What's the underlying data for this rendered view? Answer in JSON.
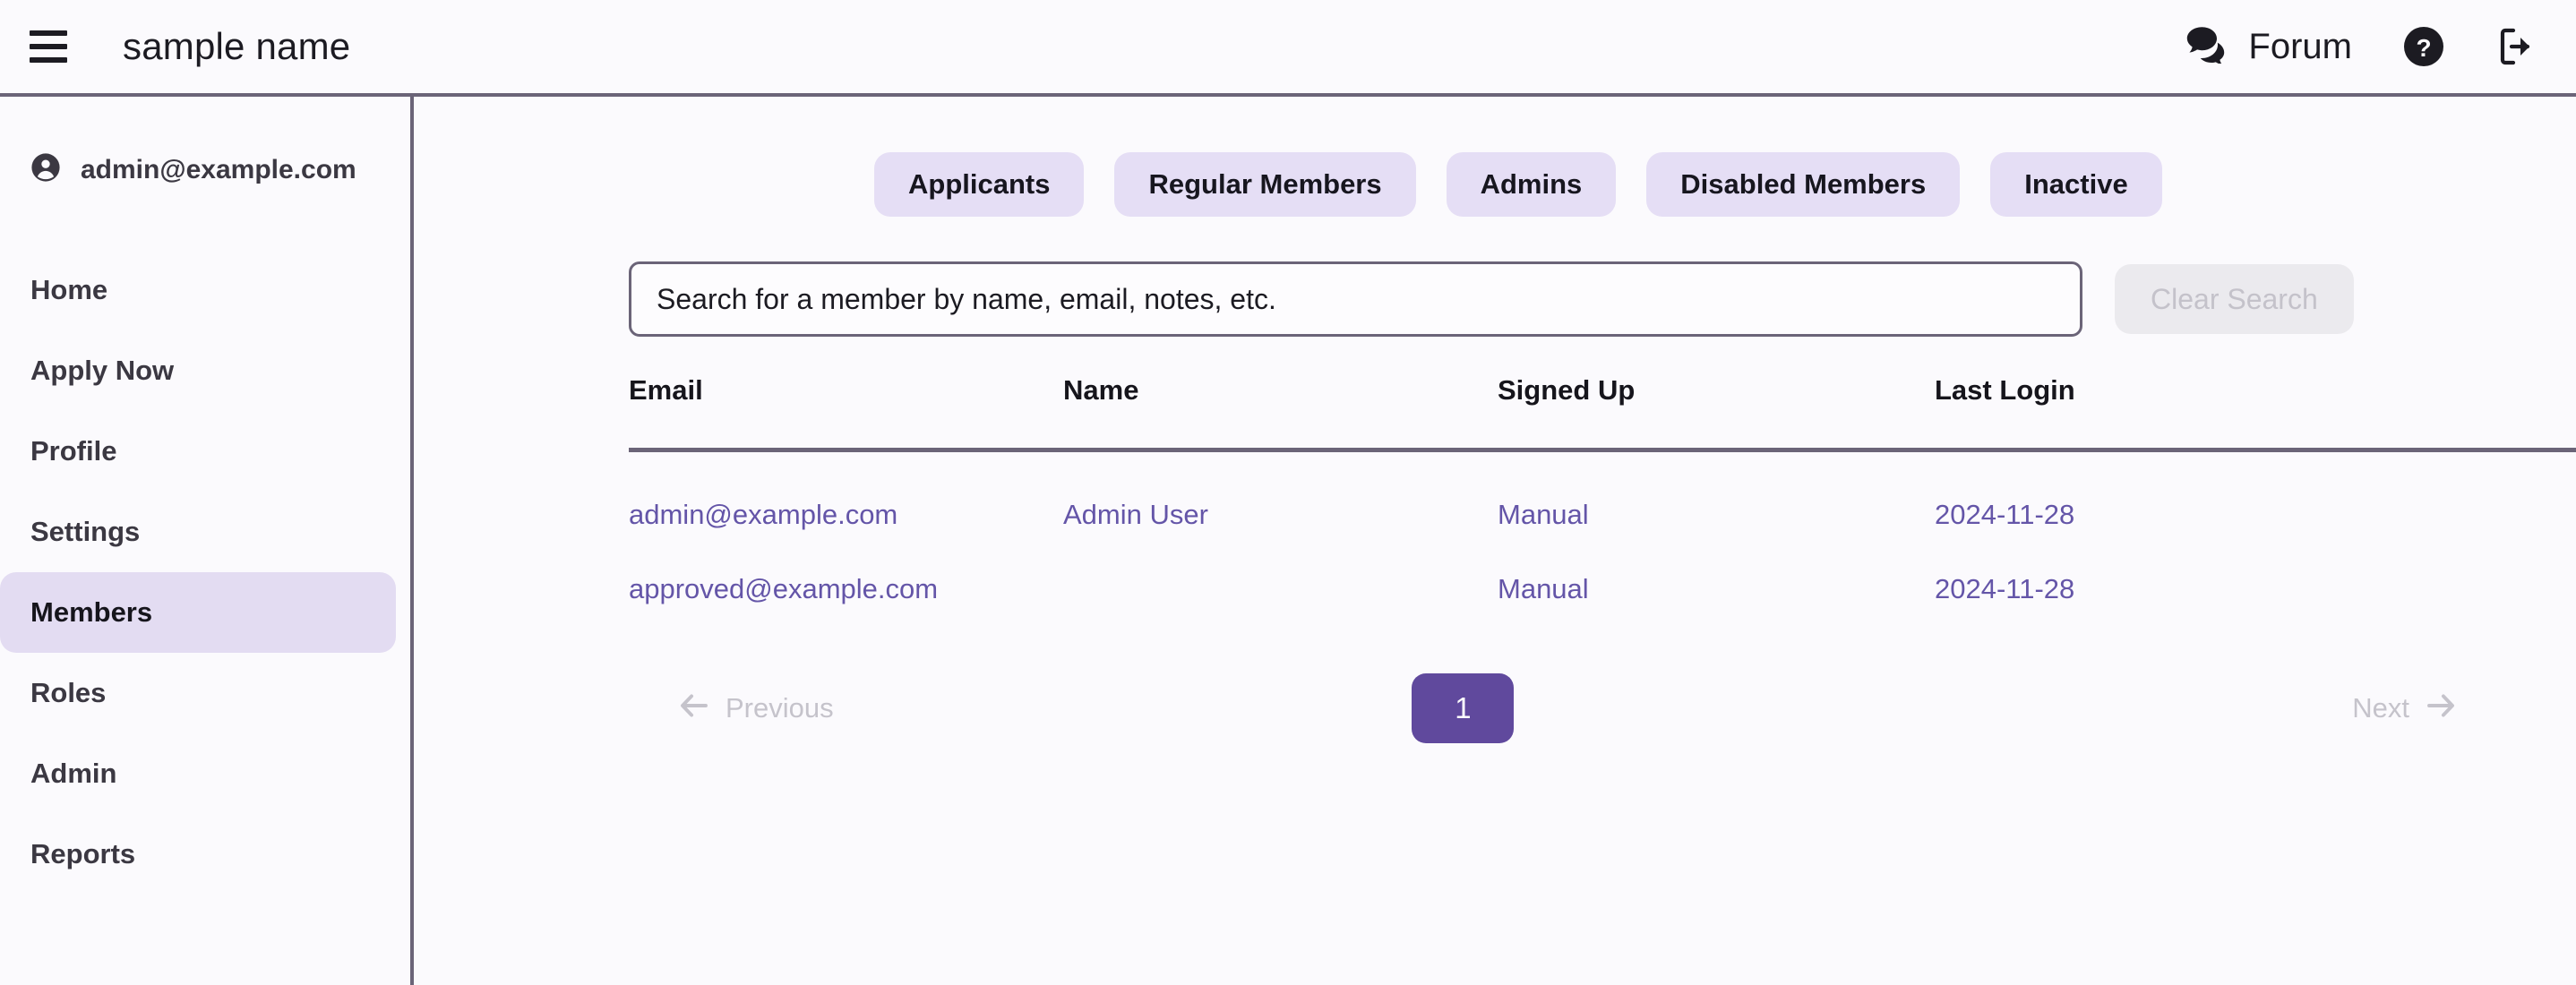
{
  "header": {
    "menu_icon": "hamburger-menu-icon",
    "title": "sample name",
    "forum_label": "Forum",
    "forum_icon": "chat-bubbles-icon",
    "help_icon": "question-mark-circle-icon",
    "logout_icon": "logout-icon"
  },
  "sidebar": {
    "account_icon": "account-circle-icon",
    "account_email": "admin@example.com",
    "items": [
      {
        "label": "Home",
        "active": false
      },
      {
        "label": "Apply Now",
        "active": false
      },
      {
        "label": "Profile",
        "active": false
      },
      {
        "label": "Settings",
        "active": false
      },
      {
        "label": "Members",
        "active": true
      },
      {
        "label": "Roles",
        "active": false
      },
      {
        "label": "Admin",
        "active": false
      },
      {
        "label": "Reports",
        "active": false
      }
    ]
  },
  "main": {
    "filters": [
      "Applicants",
      "Regular Members",
      "Admins",
      "Disabled Members",
      "Inactive"
    ],
    "search": {
      "value": "",
      "placeholder": "Search for a member by name, email, notes, etc.",
      "clear_label": "Clear Search"
    },
    "table": {
      "columns": [
        "Email",
        "Name",
        "Signed Up",
        "Last Login"
      ],
      "rows": [
        {
          "email": "admin@example.com",
          "name": "Admin User",
          "signed_up": "Manual",
          "last_login": "2024-11-28"
        },
        {
          "email": "approved@example.com",
          "name": "",
          "signed_up": "Manual",
          "last_login": "2024-11-28"
        }
      ]
    },
    "pagination": {
      "previous_label": "Previous",
      "next_label": "Next",
      "current_page": "1",
      "prev_arrow": "arrow-left-icon",
      "next_arrow": "arrow-right-icon"
    }
  },
  "colors": {
    "accent_purple": "#60499d",
    "link_purple": "#6455a8",
    "pill_bg": "#e5def5",
    "active_nav_bg": "#e3dcf2",
    "border_gray": "#6b6478",
    "page_bg": "#fbfafd",
    "disabled_text": "#c5c3cb",
    "disabled_btn_bg": "#ebeaee"
  }
}
